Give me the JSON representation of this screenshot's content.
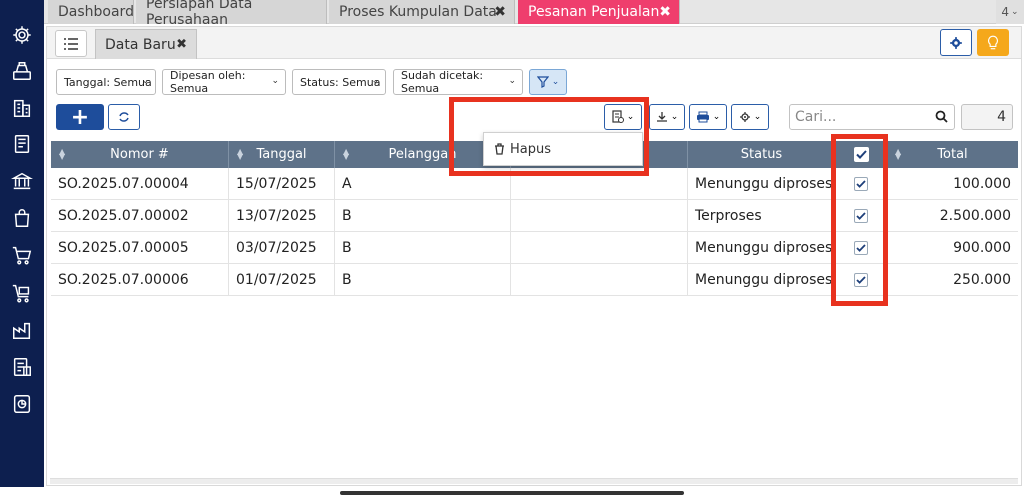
{
  "tabs": [
    {
      "label": "Dashboard"
    },
    {
      "label": "Persiapan Data Perusahaan"
    },
    {
      "label": "Proses Kumpulan Data",
      "close": "✖"
    },
    {
      "label": "Pesanan Penjualan",
      "close": "✖"
    }
  ],
  "tab_overflow": "4",
  "subtab": {
    "label": "Data Baru",
    "close": "✖"
  },
  "filters": [
    "Tanggal: Semua",
    "Dipesan oleh: Semua",
    "Status: Semua",
    "Sudah dicetak: Semua"
  ],
  "chevron": "⌄",
  "toolbar": {
    "add_label": "+"
  },
  "search": {
    "placeholder": "Cari..."
  },
  "record_count": "4",
  "dropdown": {
    "delete_label": "Hapus"
  },
  "table": {
    "columns": [
      "Nomor #",
      "Tanggal",
      "Pelanggan",
      "",
      "Status",
      "",
      "Total"
    ],
    "rows": [
      {
        "nomor": "SO.2025.07.00004",
        "tanggal": "15/07/2025",
        "pelanggan": "A",
        "status": "Menunggu diproses",
        "total": "100.000",
        "checked": true
      },
      {
        "nomor": "SO.2025.07.00002",
        "tanggal": "13/07/2025",
        "pelanggan": "B",
        "status": "Terproses",
        "total": "2.500.000",
        "checked": true
      },
      {
        "nomor": "SO.2025.07.00005",
        "tanggal": "03/07/2025",
        "pelanggan": "B",
        "status": "Menunggu diproses",
        "total": "900.000",
        "checked": true
      },
      {
        "nomor": "SO.2025.07.00006",
        "tanggal": "01/07/2025",
        "pelanggan": "B",
        "status": "Menunggu diproses",
        "total": "250.000",
        "checked": true
      }
    ]
  },
  "icons": {
    "sidebar": [
      "gear-icon",
      "cashier-icon",
      "building-icon",
      "book-icon",
      "bank-icon",
      "shopping-bag-icon",
      "cart-icon",
      "inventory-cart-icon",
      "factory-icon",
      "tax-report-icon",
      "chart-report-icon"
    ]
  },
  "colors": {
    "sidebar": "#0d1f4f",
    "active_tab": "#ef3e6d",
    "primary": "#1e4d9b",
    "table_header": "#5e7289",
    "highlight": "#e8321f",
    "bulb": "#f5a81b"
  }
}
